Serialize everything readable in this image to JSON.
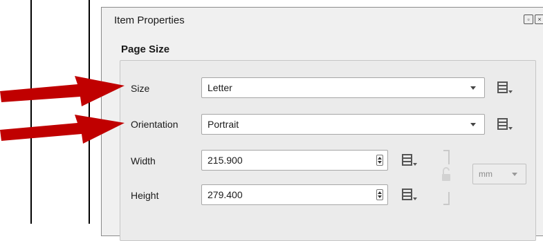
{
  "panel": {
    "title": "Item Properties",
    "section": "Page Size"
  },
  "fields": {
    "size": {
      "label": "Size",
      "value": "Letter"
    },
    "orientation": {
      "label": "Orientation",
      "value": "Portrait"
    },
    "width": {
      "label": "Width",
      "value": "215.900"
    },
    "height": {
      "label": "Height",
      "value": "279.400"
    },
    "unit": {
      "value": "mm"
    }
  },
  "icons": {
    "data_defined": "data-defined-override-icon",
    "lock": "lock-ratio-icon",
    "annotation_arrow": "red-arrow-icon"
  },
  "colors": {
    "arrow": "#c00000",
    "panel_bg": "#f0f0f0",
    "group_bg": "#ebebeb"
  }
}
